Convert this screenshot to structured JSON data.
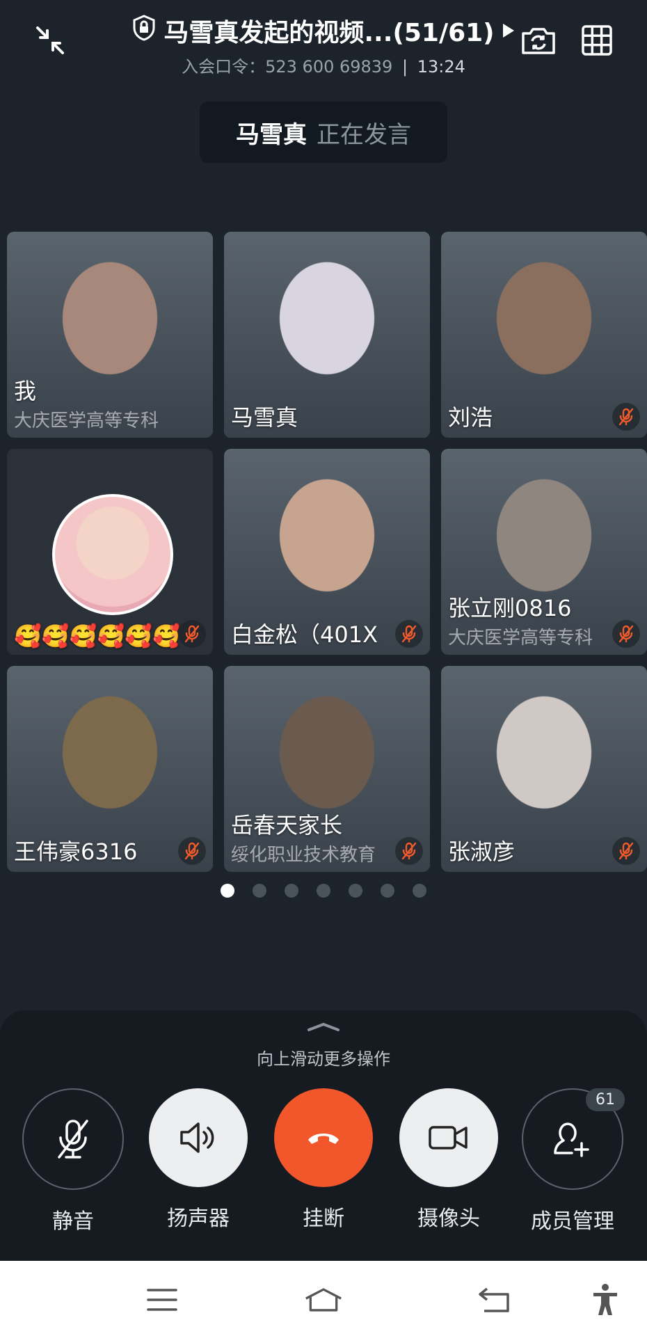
{
  "header": {
    "title": "马雪真发起的视频...(51/61)",
    "subtitle_code": "入会口令：523 600 69839",
    "separator": "|",
    "time": "13:24"
  },
  "speaker": {
    "name": "马雪真",
    "status": "正在发言"
  },
  "participants": [
    {
      "name": "我",
      "org": "大庆医学高等专科",
      "muted": false,
      "active": false,
      "face": "#a7887a"
    },
    {
      "name": "马雪真",
      "org": "",
      "muted": false,
      "active": true,
      "face": "#d8d5e0"
    },
    {
      "name": "刘浩",
      "org": "",
      "muted": true,
      "active": false,
      "face": "#8b6f5e"
    },
    {
      "name": "🥰🥰🥰🥰🥰🥰",
      "org": "",
      "muted": true,
      "active": false,
      "face": "#2a3139"
    },
    {
      "name": "白金松（401X",
      "org": "",
      "muted": true,
      "active": false,
      "face": "#c6a48f"
    },
    {
      "name": "张立刚0816",
      "org": "大庆医学高等专科",
      "muted": true,
      "active": false,
      "face": "#8f8680"
    },
    {
      "name": "王伟豪6316",
      "org": "",
      "muted": true,
      "active": false,
      "face": "#7d6a4c"
    },
    {
      "name": "岳春天家长",
      "org": "绥化职业技术教育",
      "muted": true,
      "active": false,
      "face": "#6b5a4e"
    },
    {
      "name": "张淑彦",
      "org": "",
      "muted": true,
      "active": false,
      "face": "#cfc8c4"
    }
  ],
  "pager": {
    "count": 7,
    "active": 0
  },
  "panel": {
    "hint": "向上滑动更多操作",
    "controls": [
      {
        "label": "静音",
        "icon": "mic-off-icon"
      },
      {
        "label": "扬声器",
        "icon": "speaker-icon"
      },
      {
        "label": "挂断",
        "icon": "hang-up-icon"
      },
      {
        "label": "摄像头",
        "icon": "camera-icon"
      },
      {
        "label": "成员管理",
        "icon": "add-member-icon",
        "badge": "61"
      }
    ]
  },
  "colors": {
    "active_border": "#1fbf5a",
    "hangup": "#f2562b",
    "background": "#1d232a"
  }
}
